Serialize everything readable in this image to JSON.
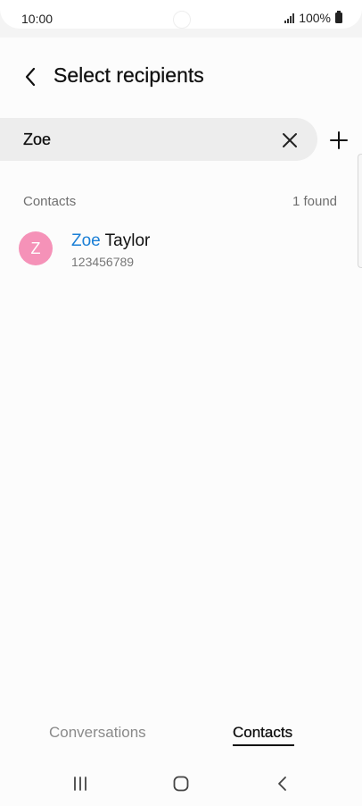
{
  "status": {
    "time": "10:00",
    "battery_text": "100%"
  },
  "header": {
    "title": "Select recipients",
    "back_icon": "chevron-left-icon"
  },
  "search": {
    "value": "Zoe",
    "clear_icon": "close-icon",
    "add_icon": "plus-icon"
  },
  "contacts_section": {
    "title": "Contacts",
    "count": "1 found"
  },
  "results": [
    {
      "initial": "Z",
      "name_match": "Zoe",
      "name_rest": " Taylor",
      "number": "123456789",
      "avatar_color": "#f592b8",
      "match_color": "#1a7fd6"
    }
  ],
  "tabs": [
    {
      "label": "Conversations",
      "selected": false
    },
    {
      "label": "Contacts",
      "selected": true
    }
  ],
  "nav": {
    "recents_icon": "recent-apps-icon",
    "home_icon": "home-icon",
    "back_icon": "back-icon"
  }
}
